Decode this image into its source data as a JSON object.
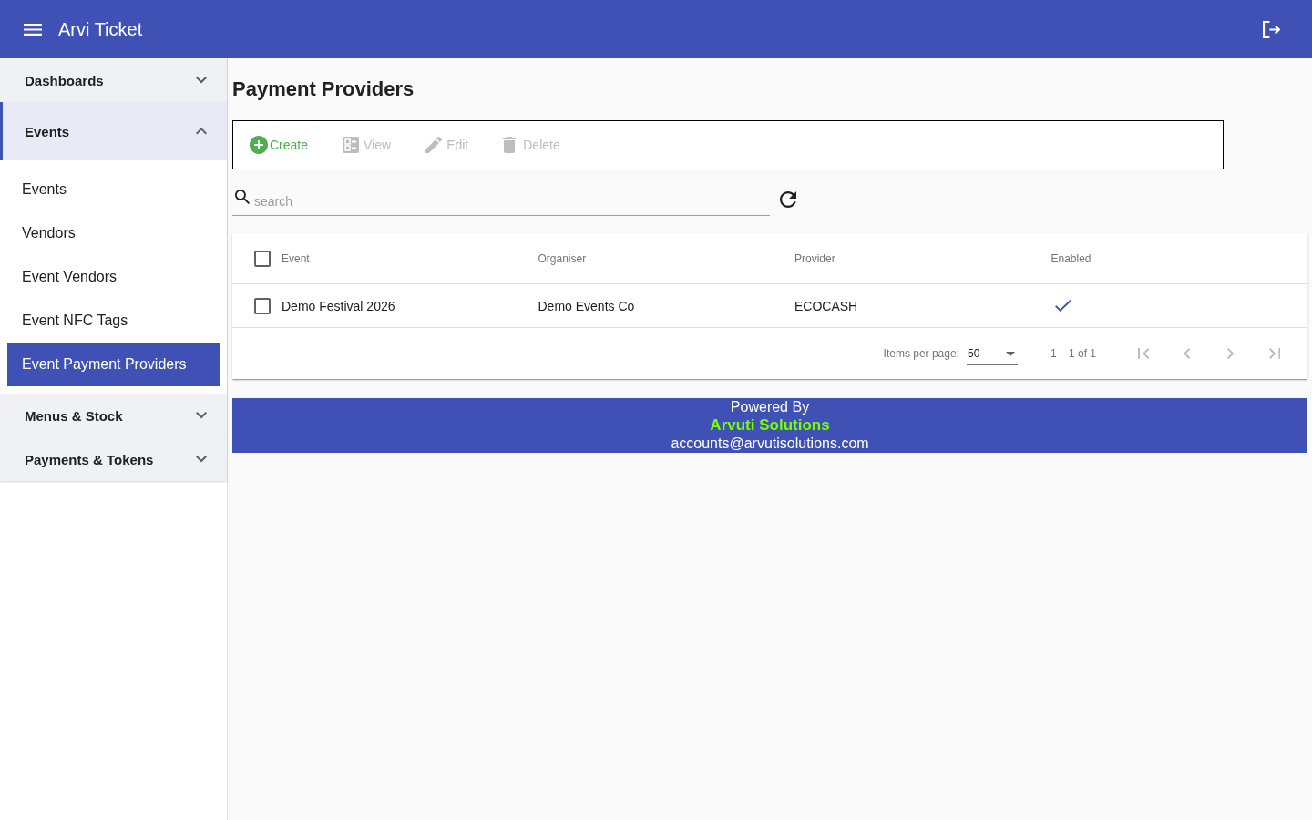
{
  "app_bar": {
    "title": "Arvi Ticket"
  },
  "sidebar": {
    "groups": [
      {
        "label": "Dashboards",
        "expanded": false
      },
      {
        "label": "Events",
        "expanded": true,
        "items": [
          {
            "label": "Events",
            "selected": false
          },
          {
            "label": "Vendors",
            "selected": false
          },
          {
            "label": "Event Vendors",
            "selected": false
          },
          {
            "label": "Event NFC Tags",
            "selected": false
          },
          {
            "label": "Event Payment Providers",
            "selected": true
          }
        ]
      },
      {
        "label": "Menus & Stock",
        "expanded": false
      },
      {
        "label": "Payments & Tokens",
        "expanded": false
      }
    ]
  },
  "page": {
    "title": "Payment Providers"
  },
  "toolbar": {
    "actions": [
      {
        "kind": "create",
        "label": "Create",
        "disabled": false
      },
      {
        "kind": "view",
        "label": "View",
        "disabled": true
      },
      {
        "kind": "edit",
        "label": "Edit",
        "disabled": true
      },
      {
        "kind": "delete",
        "label": "Delete",
        "disabled": true
      }
    ]
  },
  "search": {
    "placeholder": "search"
  },
  "table": {
    "select_all": {
      "checked": false
    },
    "columns": [
      "Event",
      "Organiser",
      "Provider",
      "Enabled"
    ],
    "rows": [
      {
        "checked": false,
        "event": "Demo Festival 2026",
        "organiser": "Demo Events Co",
        "provider": "ECOCASH",
        "enabled": true
      }
    ]
  },
  "paginator": {
    "items_per_page_label": "Items per page:",
    "page_size": "50",
    "range": "1 – 1 of 1",
    "buttons": [
      {
        "kind": "first",
        "disabled": true
      },
      {
        "kind": "previous",
        "disabled": true
      },
      {
        "kind": "next",
        "disabled": true
      },
      {
        "kind": "last",
        "disabled": true
      }
    ]
  },
  "footer": {
    "powered_by": "Powered By",
    "company": "Arvuti Solutions",
    "email": "accounts@arvutisolutions.com"
  }
}
